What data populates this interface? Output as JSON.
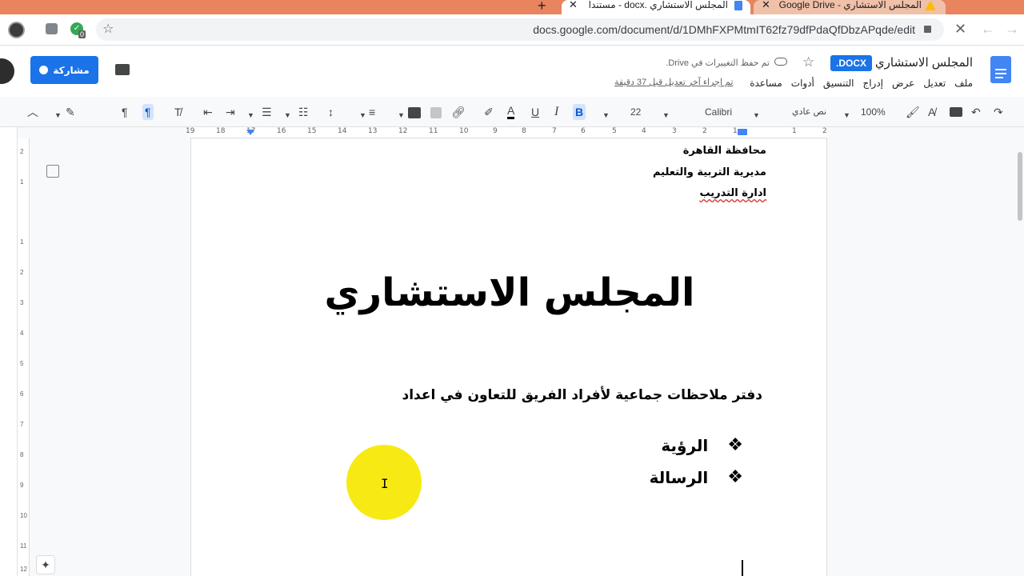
{
  "browser": {
    "tabs": [
      {
        "title": "المجلس الاستشاري .docx - مستندا",
        "state": "active"
      },
      {
        "title": "المجلس الاستشاري - Google Drive",
        "state": "inactive"
      }
    ],
    "new_tab": "+",
    "tab_close": "✕",
    "url": "docs.google.com/document/d/1DMhFXPMtmIT62fz79dfPdaQfDbzAPqde/edit",
    "extension_badge": "0"
  },
  "doc": {
    "title": "المجلس الاستشاري",
    "format_badge": ".DOCX",
    "saved_status": "تم حفظ التغييرات في Drive.",
    "last_edit": "تم إجراء آخر تعديل قبل 37 دقيقة",
    "share_label": "مشاركة",
    "menu": [
      "ملف",
      "تعديل",
      "عرض",
      "إدراج",
      "التنسيق",
      "أدوات",
      "مساعدة"
    ]
  },
  "toolbar": {
    "zoom": "100%",
    "style": "نص عادي",
    "font": "Calibri",
    "font_size": "22",
    "bold": "B",
    "italic": "I",
    "underline": "U",
    "text_color": "A"
  },
  "ruler": {
    "top_numbers": [
      "19",
      "18",
      "17",
      "16",
      "15",
      "14",
      "13",
      "12",
      "11",
      "10",
      "9",
      "8",
      "7",
      "6",
      "5",
      "4",
      "3",
      "2",
      "1",
      "1",
      "2"
    ],
    "left_numbers": [
      "2",
      "1",
      "1",
      "2",
      "3",
      "4",
      "5",
      "6",
      "7",
      "8",
      "9",
      "10",
      "11",
      "12"
    ]
  },
  "page": {
    "header_lines": [
      "محافظة القاهرة",
      "مديرية التربية والتعليم",
      "ادارة التدريب"
    ],
    "title": "المجلس الاستشاري",
    "subtitle": "دفتر ملاحظات جماعية لأفراد الفريق للتعاون في اعداد",
    "bullets": [
      "الرؤية",
      "الرسالة"
    ],
    "bullet_symbol": "❖"
  },
  "colors": {
    "tab_strip": "#e8845e",
    "accent_blue": "#1a73e8",
    "cursor_highlight": "#f7ea14"
  }
}
